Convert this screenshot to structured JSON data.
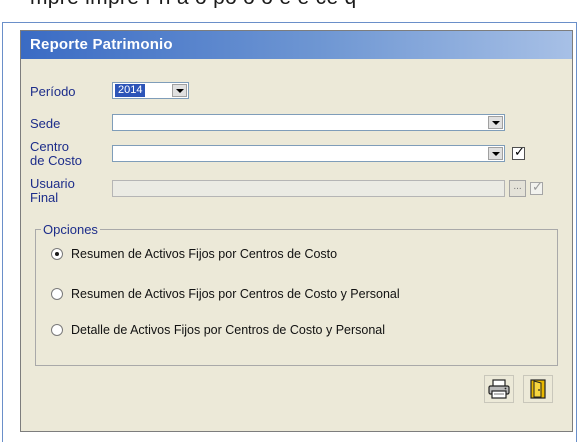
{
  "top_fragment": "mpre impre   r n  a o   po o o e e ce q",
  "window": {
    "title": "Reporte Patrimonio"
  },
  "form": {
    "periodo_label": "Período",
    "periodo_value": "2014",
    "sede_label": "Sede",
    "centro_label_line1": "Centro",
    "centro_label_line2": "de Costo",
    "usuario_label_line1": "Usuario",
    "usuario_label_line2": "Final",
    "ellipsis": "..."
  },
  "options": {
    "title": "Opciones",
    "items": [
      {
        "label": "Resumen de Activos Fijos por Centros de Costo",
        "selected": true
      },
      {
        "label": "Resumen de Activos Fijos por Centros de Costo y Personal",
        "selected": false
      },
      {
        "label": "Detalle de Activos Fijos  por Centros de Costo y Personal",
        "selected": false
      }
    ]
  },
  "toolbar": {
    "print_icon": "printer-icon",
    "exit_icon": "exit-door-icon"
  },
  "colors": {
    "title_start": "#3a6bc4",
    "title_end": "#a7c0e6",
    "label_text": "#1d2d8a",
    "window_bg": "#ece9d8",
    "exit_door": "#d59b00"
  }
}
